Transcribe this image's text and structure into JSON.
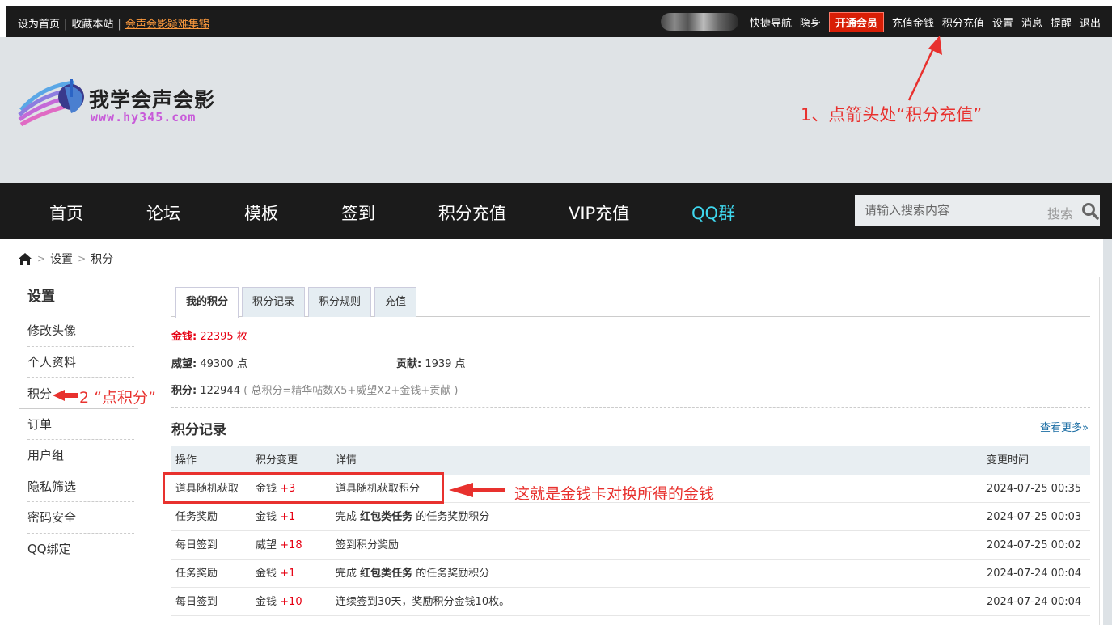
{
  "topbar": {
    "set_home": "设为首页",
    "bookmark": "收藏本站",
    "separator": "|",
    "faq_link": "会声会影疑难集锦",
    "links": [
      "快捷导航",
      "隐身"
    ],
    "vip_button": "开通会员",
    "links2": [
      "充值金钱",
      "积分充值",
      "设置",
      "消息",
      "提醒",
      "退出"
    ]
  },
  "logo": {
    "name": "我学会声会影",
    "url_text": "www.hy345.com"
  },
  "annotations": {
    "step1": "1、点箭头处“积分充值”",
    "step2": "2 “点积分”",
    "step3": "这就是金钱卡对换所得的金钱"
  },
  "nav": {
    "items": [
      "首页",
      "论坛",
      "模板",
      "签到",
      "积分充值",
      "VIP充值",
      "QQ群"
    ],
    "search_placeholder": "请输入搜索内容",
    "search_button": "搜索"
  },
  "breadcrumb": [
    "设置",
    "积分"
  ],
  "sidebar": {
    "title": "设置",
    "items": [
      "修改头像",
      "个人资料",
      "积分",
      "订单",
      "用户组",
      "隐私筛选",
      "密码安全",
      "QQ绑定"
    ]
  },
  "tabs": [
    "我的积分",
    "积分记录",
    "积分规则",
    "充值"
  ],
  "credits": {
    "money_label": "金钱:",
    "money_value": "22395 枚",
    "prestige_label": "威望:",
    "prestige_value": "49300 点",
    "contribution_label": "贡献:",
    "contribution_value": "1939 点",
    "points_label": "积分:",
    "points_value": "122944",
    "points_formula": "( 总积分=精华帖数X5+威望X2+金钱+贡献 )"
  },
  "records": {
    "title": "积分记录",
    "more_link": "查看更多»",
    "columns": [
      "操作",
      "积分变更",
      "详情",
      "变更时间"
    ],
    "rows": [
      {
        "action": "道具随机获取",
        "type": "金钱",
        "delta": "+3",
        "detail_pre": "道具随机获取积分",
        "detail_bold": "",
        "detail_post": "",
        "time": "2024-07-25 00:35"
      },
      {
        "action": "任务奖励",
        "type": "金钱",
        "delta": "+1",
        "detail_pre": "完成 ",
        "detail_bold": "红包类任务",
        "detail_post": " 的任务奖励积分",
        "time": "2024-07-25 00:03"
      },
      {
        "action": "每日签到",
        "type": "威望",
        "delta": "+18",
        "detail_pre": "签到积分奖励",
        "detail_bold": "",
        "detail_post": "",
        "time": "2024-07-25 00:02"
      },
      {
        "action": "任务奖励",
        "type": "金钱",
        "delta": "+1",
        "detail_pre": "完成 ",
        "detail_bold": "红包类任务",
        "detail_post": " 的任务奖励积分",
        "time": "2024-07-24 00:04"
      },
      {
        "action": "每日签到",
        "type": "金钱",
        "delta": "+10",
        "detail_pre": "连续签到30天，奖励积分金钱10枚。",
        "detail_bold": "",
        "detail_post": "",
        "time": "2024-07-24 00:04"
      }
    ]
  },
  "colors": {
    "topbar_bg": "#1b1b1b",
    "header_bg": "#dfe3e6",
    "annotation_red": "#e8312e",
    "qq_cyan": "#3fd7ee",
    "vip_red": "#d81e06",
    "link_blue": "#1c6ea4"
  }
}
